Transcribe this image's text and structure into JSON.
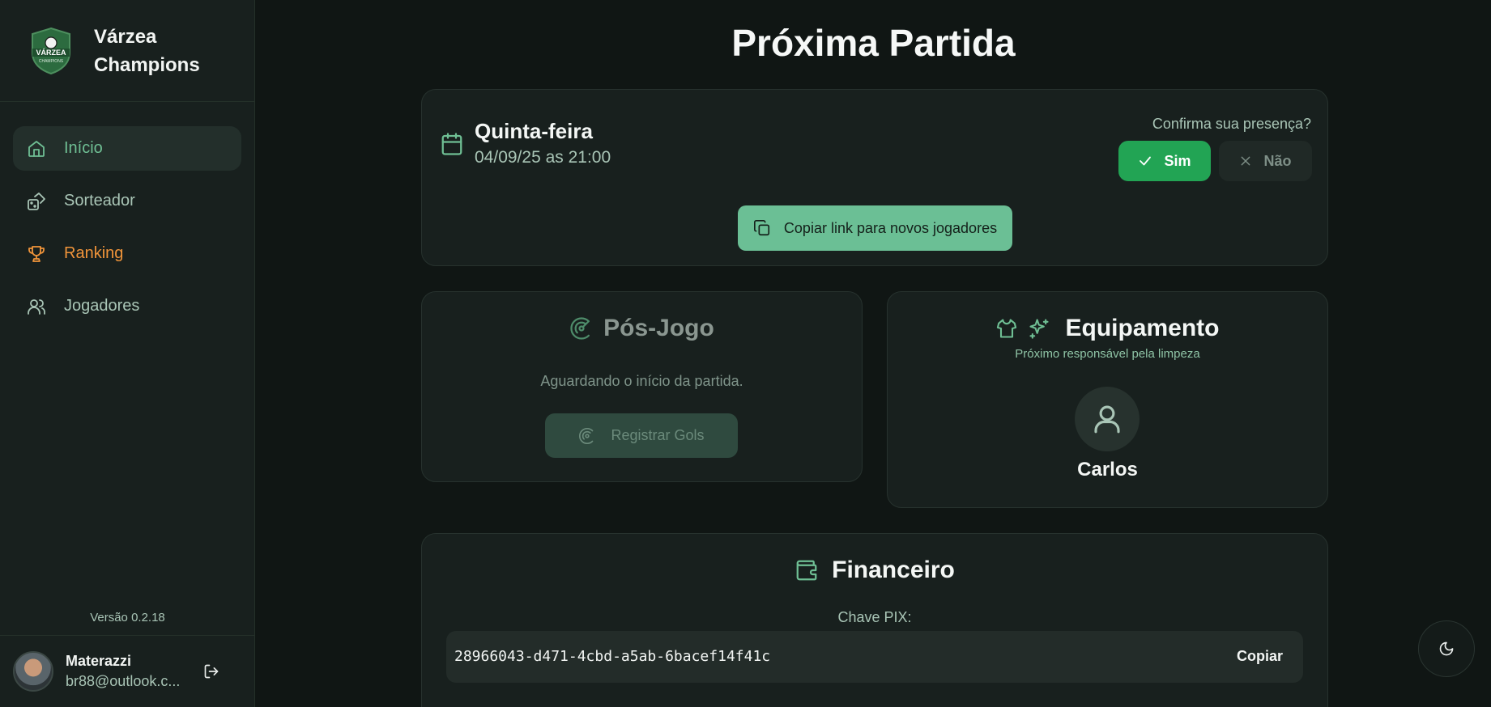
{
  "app": {
    "name": "Várzea Champions",
    "name_line1": "Várzea",
    "name_line2": "Champions",
    "logo_text": "VÁRZEA",
    "logo_subtext": "CHAMPIONS"
  },
  "sidebar": {
    "items": [
      {
        "label": "Início",
        "icon": "home-icon",
        "active": true
      },
      {
        "label": "Sorteador",
        "icon": "dice-icon"
      },
      {
        "label": "Ranking",
        "icon": "trophy-icon"
      },
      {
        "label": "Jogadores",
        "icon": "users-icon"
      }
    ],
    "version": "Versão 0.2.18"
  },
  "user": {
    "name": "Materazzi",
    "email": "br88@outlook.c..."
  },
  "page": {
    "title": "Próxima Partida"
  },
  "match": {
    "day": "Quinta-feira",
    "date": "04/09/25 as 21:00",
    "confirm_question": "Confirma sua presença?",
    "yes_label": "Sim",
    "no_label": "Não",
    "copy_link_label": "Copiar link para novos jogadores"
  },
  "post_game": {
    "title": "Pós-Jogo",
    "waiting_text": "Aguardando o início da partida.",
    "register_goals_label": "Registrar Gols"
  },
  "equipment": {
    "title": "Equipamento",
    "subtitle": "Próximo responsável pela limpeza",
    "responsible_name": "Carlos"
  },
  "finance": {
    "title": "Financeiro",
    "pix_label": "Chave PIX:",
    "pix_key": "28966043-d471-4cbd-a5ab-6bacef14f41c",
    "copy_label": "Copiar"
  },
  "colors": {
    "accent_green": "#22a454",
    "soft_green": "#6bbf95",
    "ranking_orange": "#f0943a",
    "background": "#101614",
    "card": "#18201e"
  }
}
